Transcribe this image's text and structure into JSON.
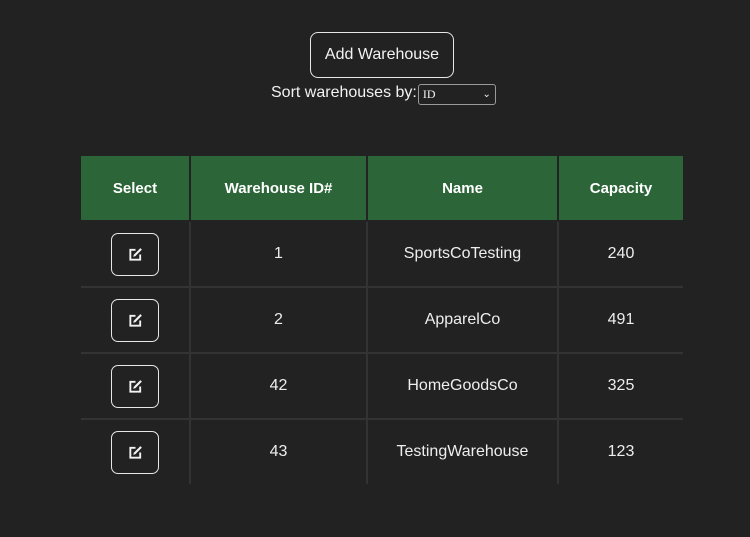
{
  "toolbar": {
    "add_label": "Add Warehouse"
  },
  "sort": {
    "label": "Sort warehouses by:",
    "selected": "ID"
  },
  "table": {
    "headers": [
      "Select",
      "Warehouse ID#",
      "Name",
      "Capacity"
    ],
    "rows": [
      {
        "id": "1",
        "name": "SportsCoTesting",
        "capacity": "240"
      },
      {
        "id": "2",
        "name": "ApparelCo",
        "capacity": "491"
      },
      {
        "id": "42",
        "name": "HomeGoodsCo",
        "capacity": "325"
      },
      {
        "id": "43",
        "name": "TestingWarehouse",
        "capacity": "123"
      }
    ]
  },
  "icons": {
    "edit": "edit-icon",
    "dropdown": "chevron-down-icon"
  },
  "colors": {
    "background": "#222222",
    "header_green": "#2c6638"
  }
}
